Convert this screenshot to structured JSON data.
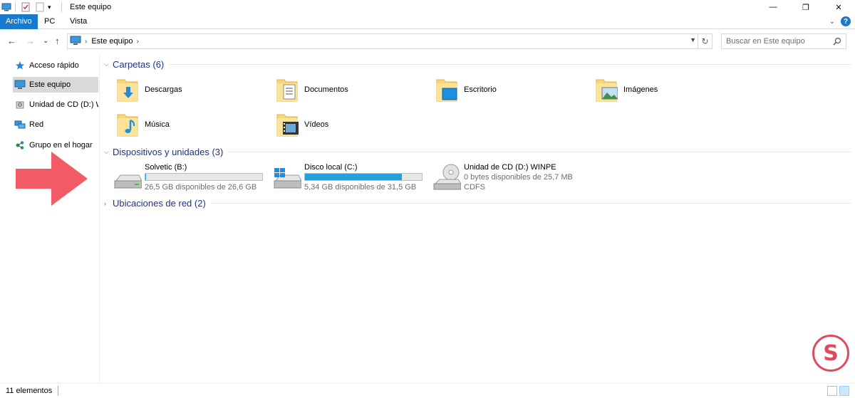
{
  "window": {
    "title": "Este equipo",
    "controls": [
      "—",
      "❐",
      "✕"
    ]
  },
  "ribbon": {
    "tabs": [
      {
        "label": "Archivo",
        "active": true
      },
      {
        "label": "PC",
        "active": false
      },
      {
        "label": "Vista",
        "active": false
      }
    ],
    "accent": "#1979ca"
  },
  "nav": {
    "back": "←",
    "forward": "→",
    "recent": "⌄",
    "up": "↑"
  },
  "address": {
    "path": "Este equipo",
    "separator": "›",
    "refresh": "↻"
  },
  "search": {
    "placeholder": "Buscar en Este equipo"
  },
  "sidebar": {
    "items": [
      {
        "label": "Acceso rápido",
        "icon": "star-icon",
        "selected": false
      },
      {
        "label": "Este equipo",
        "icon": "computer-icon",
        "selected": true
      },
      {
        "label": "Unidad de CD (D:) WI",
        "icon": "cd-drive-icon",
        "selected": false
      },
      {
        "label": "Red",
        "icon": "network-icon",
        "selected": false
      },
      {
        "label": "Grupo en el hogar",
        "icon": "homegroup-icon",
        "selected": false
      }
    ]
  },
  "groups": {
    "folders": {
      "title": "Carpetas (6)",
      "items": [
        {
          "label": "Descargas",
          "icon": "downloads-folder-icon"
        },
        {
          "label": "Documentos",
          "icon": "documents-folder-icon"
        },
        {
          "label": "Escritorio",
          "icon": "desktop-folder-icon"
        },
        {
          "label": "Imágenes",
          "icon": "pictures-folder-icon"
        },
        {
          "label": "Música",
          "icon": "music-folder-icon"
        },
        {
          "label": "Vídeos",
          "icon": "videos-folder-icon"
        }
      ]
    },
    "devices": {
      "title": "Dispositivos y unidades (3)",
      "items": [
        {
          "name": "Solvetic (B:)",
          "free": "26,5 GB disponibles de 26,6 GB",
          "used_fraction": 0.004,
          "icon": "hard-drive-icon"
        },
        {
          "name": "Disco local (C:)",
          "free": "5,34 GB disponibles de 31,5 GB",
          "used_fraction": 0.83,
          "icon": "windows-drive-icon"
        },
        {
          "name": "Unidad de CD (D:) WINPE",
          "free": "0 bytes disponibles de 25,7 MB",
          "fs": "CDFS",
          "icon": "cd-drive-icon"
        }
      ]
    },
    "network": {
      "title": "Ubicaciones de red (2)"
    }
  },
  "status": {
    "count": "11 elementos"
  },
  "colors": {
    "group_title": "#1e3287",
    "bar_fill": "#26a0da",
    "arrow": "#f25b66",
    "selected": "#d9d9d9"
  }
}
